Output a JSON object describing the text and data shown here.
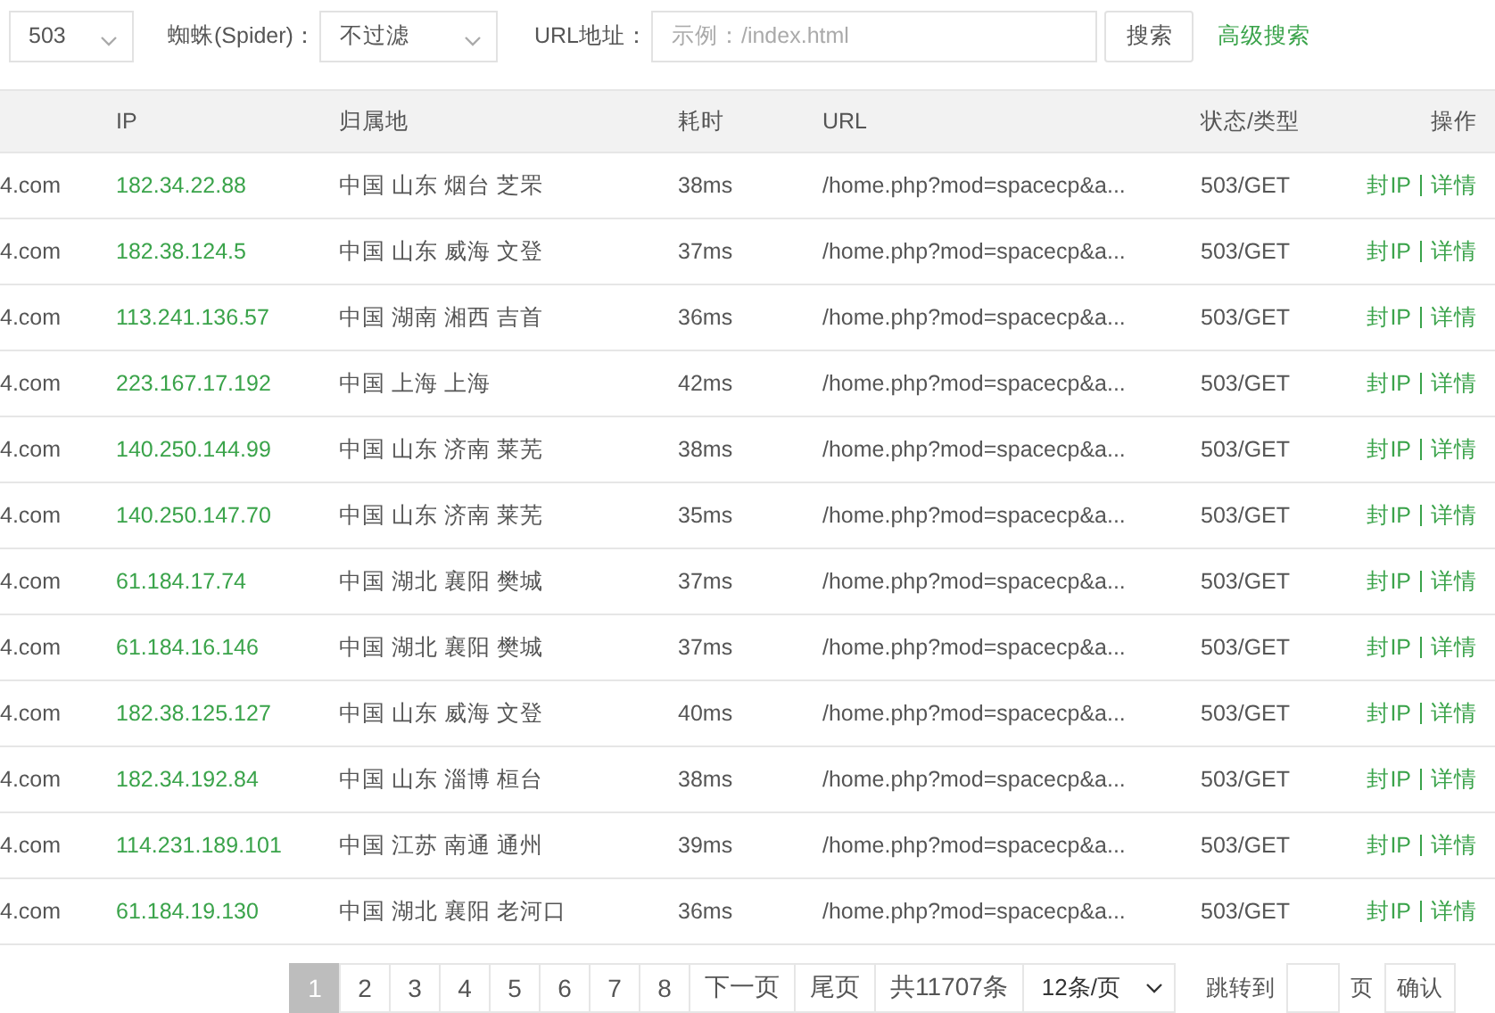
{
  "filters": {
    "status_select": {
      "value": "503"
    },
    "spider_label": "蜘蛛(Spider)：",
    "spider_select": {
      "value": "不过滤"
    },
    "url_label": "URL地址：",
    "url_input": {
      "placeholder": "示例：/index.html"
    },
    "search_button": "搜索",
    "advanced_link": "高级搜索"
  },
  "table": {
    "columns": [
      "",
      "IP",
      "归属地",
      "耗时",
      "URL",
      "状态/类型",
      "操作"
    ],
    "rows": [
      {
        "column_1": "4.com",
        "ip": "182.34.22.88",
        "location": "中国 山东 烟台 芝罘",
        "time": "38ms",
        "url": "/home.php?mod=spacecp&a...",
        "status": "503/GET",
        "actions": [
          "封IP",
          "详情"
        ]
      },
      {
        "column_1": "4.com",
        "ip": "182.38.124.5",
        "location": "中国 山东 威海 文登",
        "time": "37ms",
        "url": "/home.php?mod=spacecp&a...",
        "status": "503/GET",
        "actions": [
          "封IP",
          "详情"
        ]
      },
      {
        "column_1": "4.com",
        "ip": "113.241.136.57",
        "location": "中国 湖南 湘西 吉首",
        "time": "36ms",
        "url": "/home.php?mod=spacecp&a...",
        "status": "503/GET",
        "actions": [
          "封IP",
          "详情"
        ]
      },
      {
        "column_1": "4.com",
        "ip": "223.167.17.192",
        "location": "中国 上海 上海",
        "time": "42ms",
        "url": "/home.php?mod=spacecp&a...",
        "status": "503/GET",
        "actions": [
          "封IP",
          "详情"
        ]
      },
      {
        "column_1": "4.com",
        "ip": "140.250.144.99",
        "location": "中国 山东 济南 莱芜",
        "time": "38ms",
        "url": "/home.php?mod=spacecp&a...",
        "status": "503/GET",
        "actions": [
          "封IP",
          "详情"
        ]
      },
      {
        "column_1": "4.com",
        "ip": "140.250.147.70",
        "location": "中国 山东 济南 莱芜",
        "time": "35ms",
        "url": "/home.php?mod=spacecp&a...",
        "status": "503/GET",
        "actions": [
          "封IP",
          "详情"
        ]
      },
      {
        "column_1": "4.com",
        "ip": "61.184.17.74",
        "location": "中国 湖北 襄阳 樊城",
        "time": "37ms",
        "url": "/home.php?mod=spacecp&a...",
        "status": "503/GET",
        "actions": [
          "封IP",
          "详情"
        ]
      },
      {
        "column_1": "4.com",
        "ip": "61.184.16.146",
        "location": "中国 湖北 襄阳 樊城",
        "time": "37ms",
        "url": "/home.php?mod=spacecp&a...",
        "status": "503/GET",
        "actions": [
          "封IP",
          "详情"
        ]
      },
      {
        "column_1": "4.com",
        "ip": "182.38.125.127",
        "location": "中国 山东 威海 文登",
        "time": "40ms",
        "url": "/home.php?mod=spacecp&a...",
        "status": "503/GET",
        "actions": [
          "封IP",
          "详情"
        ]
      },
      {
        "column_1": "4.com",
        "ip": "182.34.192.84",
        "location": "中国 山东 淄博 桓台",
        "time": "38ms",
        "url": "/home.php?mod=spacecp&a...",
        "status": "503/GET",
        "actions": [
          "封IP",
          "详情"
        ]
      },
      {
        "column_1": "4.com",
        "ip": "114.231.189.101",
        "location": "中国 江苏 南通 通州",
        "time": "39ms",
        "url": "/home.php?mod=spacecp&a...",
        "status": "503/GET",
        "actions": [
          "封IP",
          "详情"
        ]
      },
      {
        "column_1": "4.com",
        "ip": "61.184.19.130",
        "location": "中国 湖北 襄阳 老河口",
        "time": "36ms",
        "url": "/home.php?mod=spacecp&a...",
        "status": "503/GET",
        "actions": [
          "封IP",
          "详情"
        ]
      }
    ]
  },
  "pagination": {
    "pages": [
      {
        "label": "1",
        "selected": true
      },
      {
        "label": "2",
        "selected": false
      },
      {
        "label": "3",
        "selected": false
      },
      {
        "label": "4",
        "selected": false
      },
      {
        "label": "5",
        "selected": false
      },
      {
        "label": "6",
        "selected": false
      },
      {
        "label": "7",
        "selected": false
      },
      {
        "label": "8",
        "selected": false
      }
    ],
    "next": "下一页",
    "last": "尾页",
    "total": "共11707条",
    "per_page_select": {
      "value": "12条/页"
    },
    "jump_label": "跳转到",
    "page_unit": "页",
    "confirm_button": "确认"
  }
}
